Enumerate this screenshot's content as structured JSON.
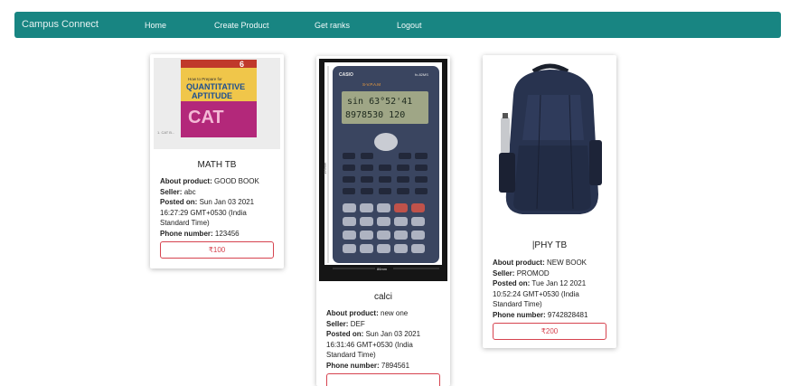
{
  "navbar": {
    "brand": "Campus Connect",
    "links": [
      "Home",
      "Create Product",
      "Get ranks",
      "Logout"
    ]
  },
  "products": [
    {
      "title": "MATH TB",
      "about_label": "About product:",
      "about": "GOOD BOOK",
      "seller_label": "Seller:",
      "seller": "abc",
      "posted_label": "Posted on:",
      "posted": "Sun Jan 03 2021 16:27:29 GMT+0530 (India Standard Time)",
      "phone_label": "Phone number:",
      "phone": "123456",
      "price": "₹100",
      "image": {
        "publisher_badge": "6",
        "line1": "How to Prepare for",
        "line2": "QUANTITATIVE",
        "line3": "APTITUDE",
        "line4": "CAT",
        "corner_text": "1. CAT B..."
      }
    },
    {
      "title": "calci",
      "about_label": "About product:",
      "about": "new one",
      "seller_label": "Seller:",
      "seller": "DEF",
      "posted_label": "Posted on:",
      "posted": "Sun Jan 03 2021 16:31:46 GMT+0530 (India Standard Time)",
      "phone_label": "Phone number:",
      "phone": "7894561",
      "price": "",
      "image": {
        "brand": "CASIO",
        "model": "fx-82MS",
        "label_svpam": "S-V.P.A.M",
        "display_top": "sin 63°52'41",
        "display_bottom": "8978530 120",
        "dim_height": "156mm",
        "dim_width": "86mm"
      }
    },
    {
      "title": "|PHY TB",
      "about_label": "About product:",
      "about": "NEW BOOK",
      "seller_label": "Seller:",
      "seller": "PROMOD",
      "posted_label": "Posted on:",
      "posted": "Tue Jan 12 2021 10:52:24 GMT+0530 (India Standard Time)",
      "phone_label": "Phone number:",
      "phone": "9742828481",
      "price": "₹200",
      "image": {}
    }
  ],
  "colors": {
    "navbar": "#188582",
    "price_border": "#d6434f"
  }
}
